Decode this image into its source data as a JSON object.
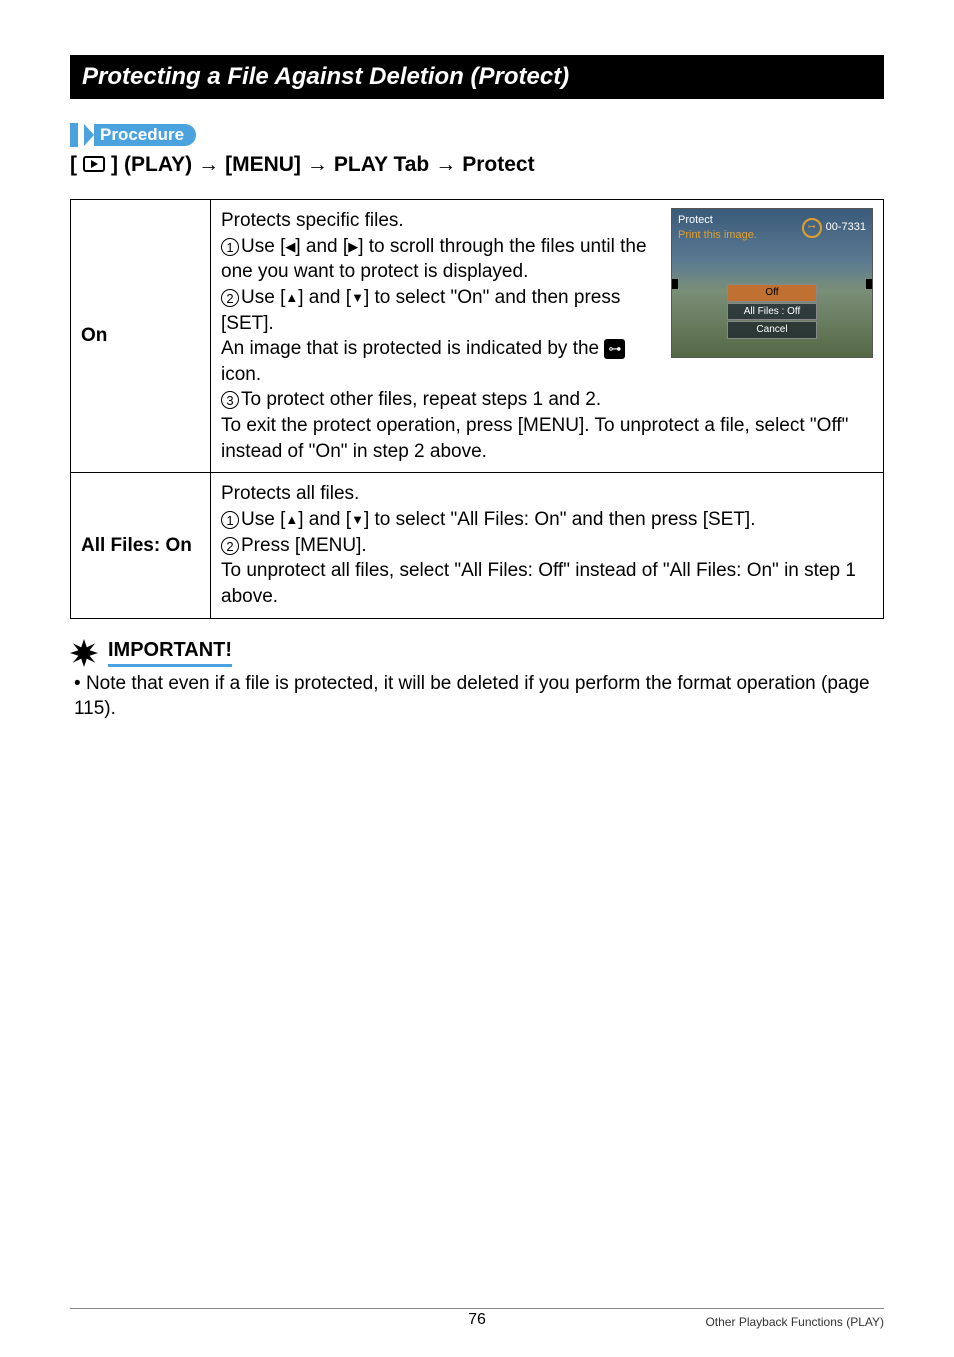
{
  "section_title": "Protecting a File Against Deletion (Protect)",
  "procedure_label": "Procedure",
  "breadcrumb": {
    "play": "(PLAY)",
    "menu": "[MENU]",
    "tab": "PLAY Tab",
    "item": "Protect"
  },
  "table": {
    "row1": {
      "label": "On",
      "intro": "Protects specific files.",
      "s1a": "Use [",
      "s1b": "] and [",
      "s1c": "] to scroll through the files until the one you want to protect is displayed.",
      "s2a": "Use [",
      "s2b": "] and [",
      "s2c": "] to select \"On\" and then press [SET].",
      "indicated_a": "An image that is protected is indicated by the ",
      "indicated_b": " icon.",
      "s3": "To protect other files, repeat steps 1 and 2.",
      "exit": "To exit the protect operation, press [MENU]. To unprotect a file, select \"Off\" instead of \"On\" in step 2 above."
    },
    "row2": {
      "label": "All Files: On",
      "intro": "Protects all files.",
      "s1a": "Use [",
      "s1b": "] and [",
      "s1c": "] to select \"All Files: On\" and then press [SET].",
      "s2": "Press [MENU].",
      "exit": "To unprotect all files, select \"All Files: Off\" instead of \"All Files: On\" in step 1 above."
    }
  },
  "camera": {
    "title": "Protect",
    "subtitle": "Print this image.",
    "counter": "00-7331",
    "opt_off": "Off",
    "opt_all": "All Files : Off",
    "opt_cancel": "Cancel"
  },
  "important_label": "IMPORTANT!",
  "important_note": "Note that even if a file is protected, it will be deleted if you perform the format operation (page 115).",
  "footer": {
    "page": "76",
    "section": "Other Playback Functions (PLAY)"
  }
}
